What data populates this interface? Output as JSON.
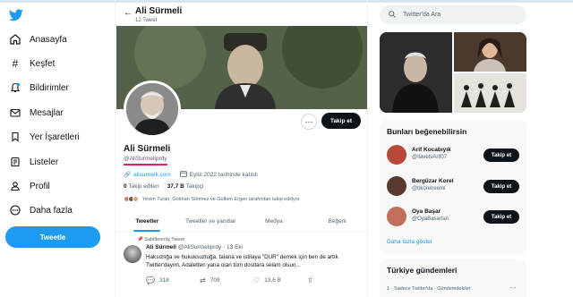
{
  "nav": {
    "items": [
      {
        "label": "Anasayfa",
        "icon": "home-icon"
      },
      {
        "label": "Keşfet",
        "icon": "hashtag-icon"
      },
      {
        "label": "Bildirimler",
        "icon": "bell-icon"
      },
      {
        "label": "Mesajlar",
        "icon": "envelope-icon"
      },
      {
        "label": "Yer İşaretleri",
        "icon": "bookmark-icon"
      },
      {
        "label": "Listeler",
        "icon": "list-icon"
      },
      {
        "label": "Profil",
        "icon": "person-icon"
      },
      {
        "label": "Daha fazla",
        "icon": "more-circle-icon"
      }
    ],
    "tweet_button": "Tweetle"
  },
  "header": {
    "name": "Ali Sürmeli",
    "tweet_count": "12 Tweet"
  },
  "profile": {
    "name": "Ali Sürmeli",
    "handle": "@AliSurmeliprdy",
    "website": "alisurmeli.com",
    "joined": "Eylül 2022 tarihinde katıldı",
    "following_count": "0",
    "following_label": "Takip edilen",
    "followers_count": "37,7 B",
    "followers_label": "Takipçi",
    "followed_by": "Yesim Turan, Gökhan Sönmez ve Gülben Ergen tarafından takip ediliyor",
    "follow_button": "Takip et",
    "more_button": "···"
  },
  "tabs": [
    "Tweetler",
    "Tweetler ve yanıtlar",
    "Medya",
    "Beğeni"
  ],
  "tweet": {
    "pinned_label": "Sabitlenmiş Tweet",
    "name": "Ali Sürmeli",
    "meta": "@AliSurmeliprdy · 13 Eki",
    "text": "Haksızlığa ve hukuksuzluğa, talana ve istilaya \"DUR\" demek için ben de artık Twitter'dayım. Adaletten yana olan tüm dostlara selam olsun...",
    "replies": "318",
    "retweets": "709",
    "likes": "13,6 B"
  },
  "search": {
    "placeholder": "Twitter'da Ara"
  },
  "suggestions": {
    "title": "Bunları beğenebilirsin",
    "items": [
      {
        "name": "Arif Kocabıyık",
        "handle": "@IlavetvArif07",
        "button": "Takip et",
        "color": "#b84a3a"
      },
      {
        "name": "Bergüzar Korel",
        "handle": "@bkorelreeml",
        "button": "Takip et",
        "color": "#5a3a2e"
      },
      {
        "name": "Oya Başar",
        "handle": "@OyaBasarfan",
        "button": "Takip et",
        "color": "#c0705a"
      }
    ],
    "more": "Daha fazla göster"
  },
  "trends": {
    "title": "Türkiye gündemleri",
    "item": "1 · Sadece Twitter'da · Gündemdekiler",
    "more": "···"
  },
  "colors": {
    "accent": "#1d9bf0",
    "dark": "#0f1419",
    "muted": "#536471"
  }
}
